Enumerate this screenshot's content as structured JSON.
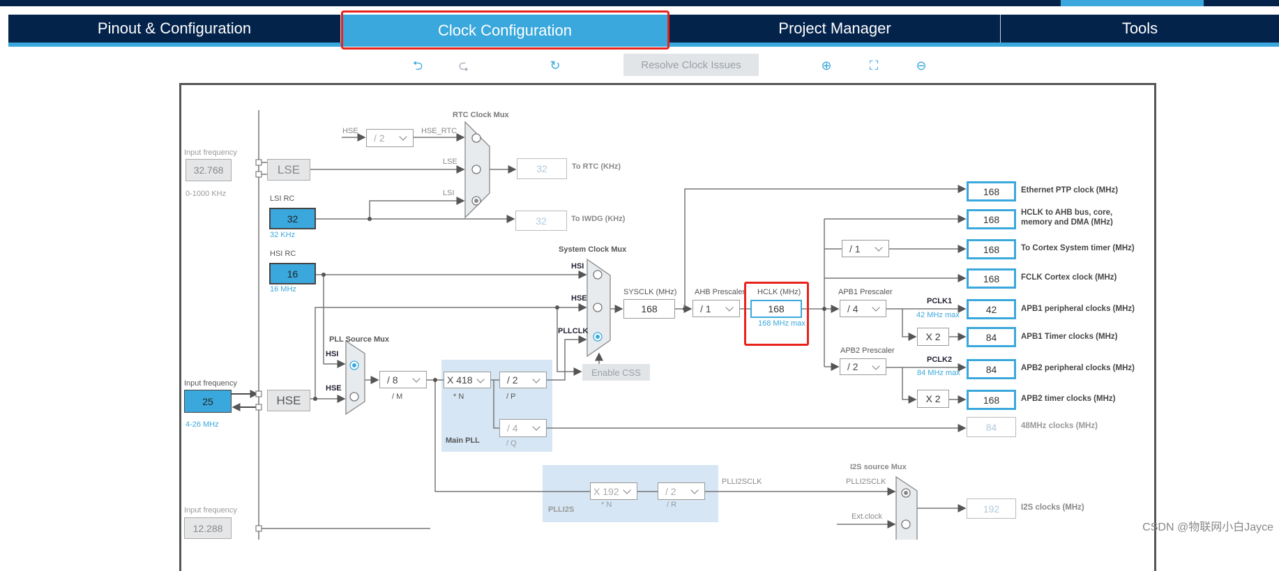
{
  "tabs": [
    {
      "label": "Pinout & Configuration"
    },
    {
      "label": "Clock Configuration",
      "active": true
    },
    {
      "label": "Project Manager"
    },
    {
      "label": "Tools"
    }
  ],
  "toolbar": {
    "undo_icon": "undo-icon",
    "redo_icon": "redo-icon",
    "reset_icon": "refresh-icon",
    "resolve": "Resolve Clock Issues",
    "zoom_in_icon": "zoom-in-icon",
    "fit_icon": "fit-screen-icon",
    "zoom_out_icon": "zoom-out-icon"
  },
  "colors": {
    "navy": "#03234b",
    "accent": "#3aa8dc",
    "highlight": "#e8221b"
  },
  "inputs": {
    "lse": {
      "label": "Input frequency",
      "value": "32.768",
      "range": "0-1000 KHz",
      "source": "LSE"
    },
    "lsi": {
      "label": "LSI RC",
      "value": "32",
      "unit": "32 KHz"
    },
    "hsi": {
      "label": "HSI RC",
      "value": "16",
      "unit": "16 MHz"
    },
    "hse": {
      "label": "Input frequency",
      "value": "25",
      "range": "4-26 MHz",
      "source": "HSE"
    },
    "ext": {
      "label": "Input frequency",
      "value": "12.288"
    }
  },
  "rtc": {
    "title": "RTC Clock Mux",
    "hse_label": "HSE",
    "hse_div": "/ 2",
    "hse_rtc": "HSE_RTC",
    "lse": "LSE",
    "lsi": "LSI",
    "rtc_value": "32",
    "rtc_label": "To RTC (KHz)",
    "iwdg_value": "32",
    "iwdg_label": "To IWDG (KHz)"
  },
  "sysmux": {
    "title": "System Clock Mux",
    "hsi": "HSI",
    "hse": "HSE",
    "pllclk": "PLLCLK",
    "enable_css": "Enable CSS"
  },
  "pllmux": {
    "title": "PLL Source Mux",
    "hsi": "HSI",
    "hse": "HSE"
  },
  "pll": {
    "m": "/ 8",
    "m_label": "/ M",
    "n": "X 418",
    "n_label": "* N",
    "p": "/ 2",
    "p_label": "/ P",
    "q": "/ 4",
    "q_label": "/ Q",
    "title": "Main PLL"
  },
  "sysclk": {
    "label": "SYSCLK (MHz)",
    "value": "168"
  },
  "ahb": {
    "label": "AHB Prescaler",
    "value": "/ 1"
  },
  "hclk": {
    "label": "HCLK (MHz)",
    "value": "168",
    "max": "168 MHz max"
  },
  "cortex_div": "/ 1",
  "apb1": {
    "label": "APB1 Prescaler",
    "value": "/ 4",
    "pclk": "PCLK1",
    "max": "42 MHz max",
    "mult": "X 2"
  },
  "apb2": {
    "label": "APB2 Prescaler",
    "value": "/ 2",
    "pclk": "PCLK2",
    "max": "84 MHz max",
    "mult": "X 2"
  },
  "outputs": [
    {
      "value": "168",
      "label": "Ethernet PTP clock (MHz)"
    },
    {
      "value": "168",
      "label": "HCLK to AHB bus, core, memory and DMA (MHz)"
    },
    {
      "value": "168",
      "label": "To Cortex System timer (MHz)"
    },
    {
      "value": "168",
      "label": "FCLK Cortex clock (MHz)"
    },
    {
      "value": "42",
      "label": "APB1 peripheral clocks (MHz)"
    },
    {
      "value": "84",
      "label": "APB1 Timer clocks (MHz)"
    },
    {
      "value": "84",
      "label": "APB2 peripheral clocks (MHz)"
    },
    {
      "value": "168",
      "label": "APB2 timer clocks (MHz)"
    },
    {
      "value": "84",
      "label": "48MHz clocks (MHz)"
    },
    {
      "value": "192",
      "label": "I2S clocks (MHz)"
    }
  ],
  "plli2s": {
    "title": "PLLI2S",
    "n": "X 192",
    "n_label": "* N",
    "r": "/ 2",
    "r_label": "/ R",
    "out": "PLLI2SCLK"
  },
  "i2smux": {
    "title": "I2S source Mux",
    "plli2sclk": "PLLI2SCLK",
    "ext": "Ext.clock"
  },
  "watermark": "CSDN @物联网小白Jayce"
}
